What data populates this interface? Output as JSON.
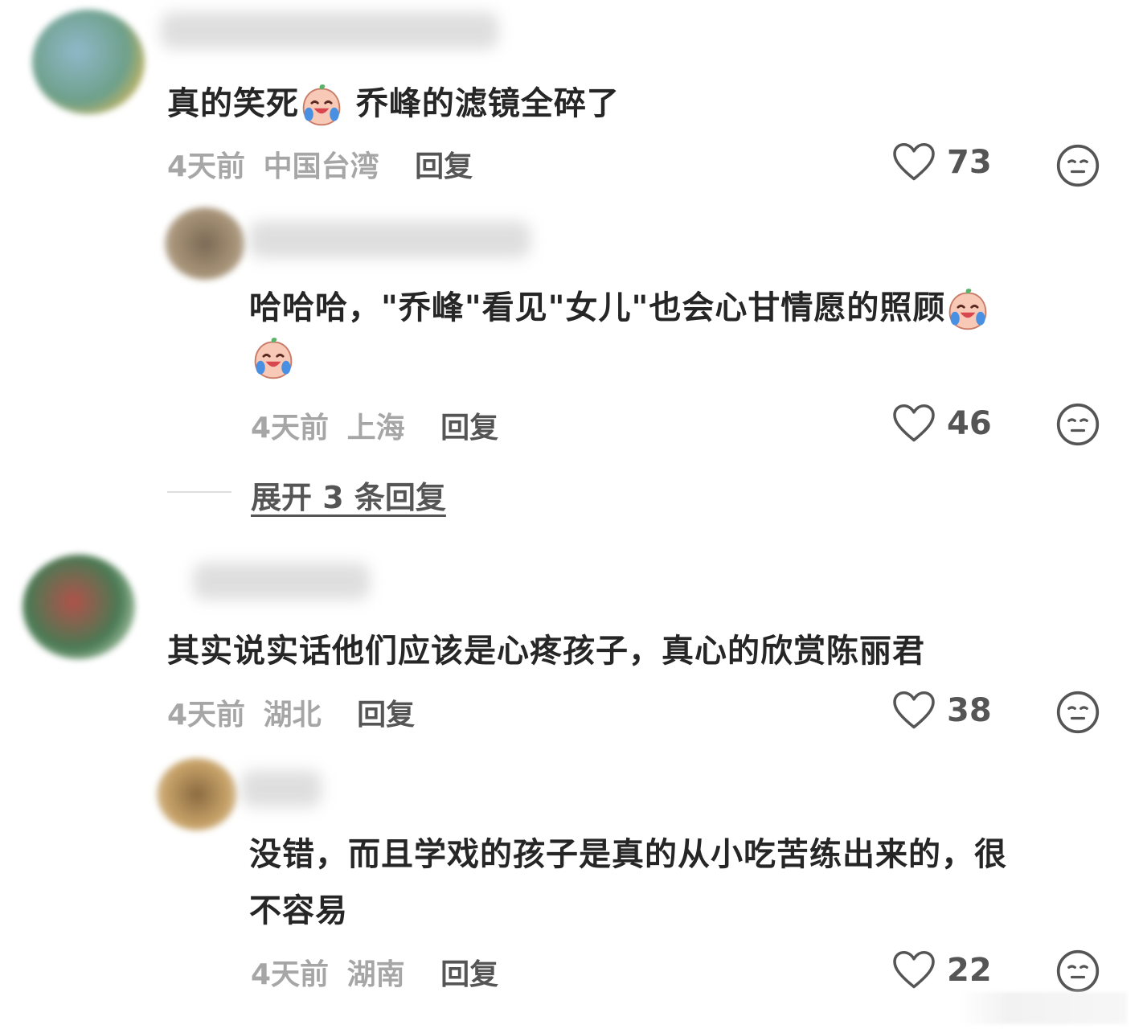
{
  "comments": [
    {
      "text_a": "真的笑死",
      "emoji_a": "crying-laughing-emoji",
      "text_b": " 乔峰的滤镜全碎了",
      "time": "4天前",
      "location": "中国台湾",
      "reply_label": "回复",
      "likes": "73"
    },
    {
      "text_line1": "哈哈哈，\"乔峰\"看见\"女儿\"也会心甘情愿的照顾",
      "time": "4天前",
      "location": "上海",
      "reply_label": "回复",
      "likes": "46"
    },
    {
      "text": "其实说实话他们应该是心疼孩子，真心的欣赏陈丽君",
      "time": "4天前",
      "location": "湖北",
      "reply_label": "回复",
      "likes": "38"
    },
    {
      "text_line1": "没错，而且学戏的孩子是真的从小吃苦练出来的，很",
      "text_line2": "不容易",
      "time": "4天前",
      "location": "湖南",
      "reply_label": "回复",
      "likes": "22"
    }
  ],
  "expand_replies": "展开 3 条回复",
  "colors": {
    "meta": "#a6a6a6",
    "text": "#262626",
    "accent": "#555555"
  }
}
